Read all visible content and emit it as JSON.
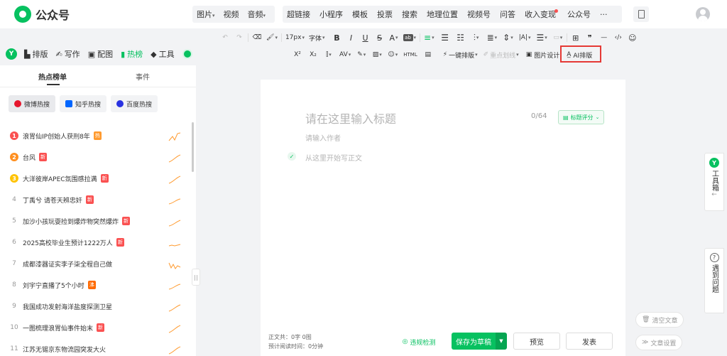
{
  "header": {
    "logo_text": "公众号",
    "insert_group_1": [
      "图片",
      "视频",
      "音频"
    ],
    "insert_group_2": [
      "超链接",
      "小程序",
      "模板",
      "投票",
      "搜索",
      "地理位置",
      "视频号",
      "问答",
      "收入变现",
      "公众号"
    ],
    "more": "···"
  },
  "toolbar": {
    "font_size": "17px",
    "font_family": "字体",
    "bold": "B",
    "italic": "I",
    "underline": "U",
    "strike": "S",
    "color": "A",
    "superscript": "X²",
    "subscript": "X₂",
    "one_click_layout": "一键排版",
    "key_underline": "重点划线",
    "image_design": "图片设计",
    "ai_layout": "AI排版",
    "quote": "❞",
    "code": "‹/›"
  },
  "left_tabs": [
    "排版",
    "写作",
    "配图",
    "热榜",
    "工具"
  ],
  "active_left_tab": "热榜",
  "sidebar": {
    "tabs": [
      "热点榜单",
      "事件"
    ],
    "chips": [
      "微博热搜",
      "知乎热搜",
      "百度热搜"
    ],
    "items": [
      {
        "rank": "1",
        "title": "浪胃仙IP创始人获刑8年",
        "tag": "热",
        "tag_color": "#ff9a2e"
      },
      {
        "rank": "2",
        "title": "台风",
        "tag": "新",
        "tag_color": "#fa5151"
      },
      {
        "rank": "3",
        "title": "大洋彼岸APEC氛围感拉满",
        "tag": "新",
        "tag_color": "#fa5151"
      },
      {
        "rank": "4",
        "title": "丁禹兮 请苍天辨忠奸",
        "tag": "新",
        "tag_color": "#fa5151"
      },
      {
        "rank": "5",
        "title": "加沙小孩玩耍捡到爆炸物突然爆炸",
        "tag": "新",
        "tag_color": "#fa5151"
      },
      {
        "rank": "6",
        "title": "2025高校毕业生预计1222万人",
        "tag": "新",
        "tag_color": "#fa5151"
      },
      {
        "rank": "7",
        "title": "成都漆器证实李子柒全程自己做",
        "tag": "",
        "tag_color": ""
      },
      {
        "rank": "8",
        "title": "刘宇宁直播了5个小时",
        "tag": "沸",
        "tag_color": "#ff6a00"
      },
      {
        "rank": "9",
        "title": "我国成功发射海洋盐度探测卫星",
        "tag": "",
        "tag_color": ""
      },
      {
        "rank": "10",
        "title": "一图梳理浪胃仙事件始末",
        "tag": "新",
        "tag_color": "#fa5151"
      },
      {
        "rank": "11",
        "title": "江苏无锡京东物流园突发大火",
        "tag": "",
        "tag_color": ""
      }
    ]
  },
  "editor": {
    "title_placeholder": "请在这里输入标题",
    "title_count": "0/64",
    "score_button": "标题评分",
    "author_placeholder": "请输入作者",
    "body_placeholder": "从这里开始写正文"
  },
  "footer": {
    "word_count": "正文共：0字 0图",
    "read_time": "预计阅读时间：0分钟",
    "check": "违规检测",
    "save": "保存为草稿",
    "preview": "预览",
    "publish": "发表"
  },
  "right_float": {
    "toolbox": "工具箱",
    "help": "遇到问题"
  },
  "pills": {
    "clear": "清空文章",
    "settings": "文章设置"
  },
  "colors": {
    "brand": "#07c160",
    "highlight": "#e53935"
  }
}
